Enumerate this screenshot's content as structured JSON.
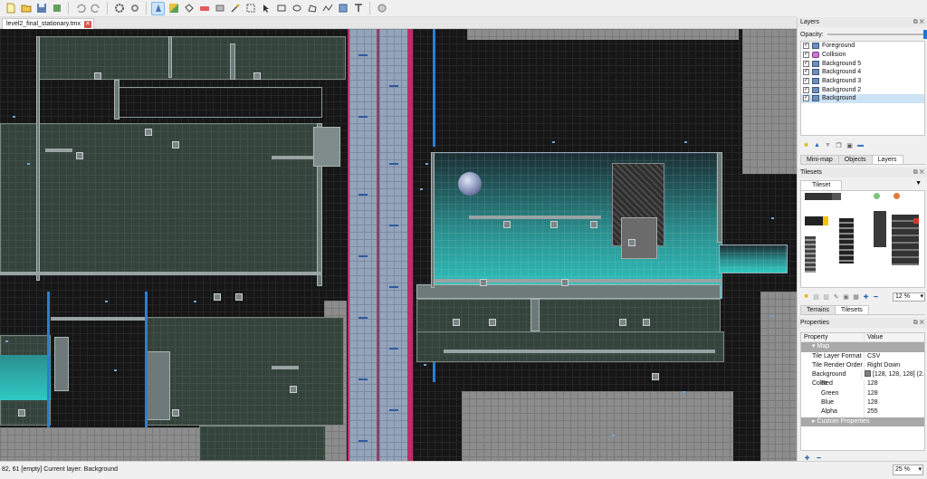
{
  "toolbar": {
    "items": [
      "new-file-icon",
      "open-file-icon",
      "save-icon",
      "export-icon",
      "undo-icon",
      "redo-icon",
      "command-icon",
      "tileset-icon",
      "stamp-brush-icon",
      "terrain-brush-icon",
      "bucket-fill-icon",
      "eraser-icon",
      "rect-select-icon",
      "magic-wand-icon",
      "select-same-icon",
      "select-objects-icon",
      "rectangle-icon",
      "ellipse-icon",
      "polygon-icon",
      "polyline-icon",
      "tile-object-icon",
      "text-object-icon",
      "random-mode-icon"
    ]
  },
  "document": {
    "tab_label": "level2_final_stationary.tmx"
  },
  "layers": {
    "title": "Layers",
    "opacity_label": "Opacity:",
    "items": [
      {
        "name": "Foreground",
        "type": "tile"
      },
      {
        "name": "Collision",
        "type": "object"
      },
      {
        "name": "Background 5",
        "type": "tile"
      },
      {
        "name": "Background 4",
        "type": "tile"
      },
      {
        "name": "Background 3",
        "type": "tile"
      },
      {
        "name": "Background 2",
        "type": "tile"
      },
      {
        "name": "Background",
        "type": "tile",
        "selected": true
      }
    ],
    "tabs": [
      "Mini-map",
      "Objects",
      "Layers"
    ],
    "active_tab": "Layers"
  },
  "tilesets": {
    "title": "Tilesets",
    "tab_label": "Tileset",
    "zoom": "12 %",
    "tabs": [
      "Terrains",
      "Tilesets"
    ]
  },
  "properties": {
    "title": "Properties",
    "col_property": "Property",
    "col_value": "Value",
    "map_group": "Map",
    "rows": [
      {
        "k": "Tile Layer Format",
        "v": "CSV"
      },
      {
        "k": "Tile Render Order",
        "v": "Right Down"
      },
      {
        "k": "Background Color",
        "v": "[128, 128, 128] (2..."
      },
      {
        "k": "Red",
        "v": "128"
      },
      {
        "k": "Green",
        "v": "128"
      },
      {
        "k": "Blue",
        "v": "128"
      },
      {
        "k": "Alpha",
        "v": "255"
      }
    ],
    "custom_group": "Custom Properties"
  },
  "status": {
    "text": "82, 61 [empty]  Current layer: Background",
    "zoom": "25 %"
  }
}
